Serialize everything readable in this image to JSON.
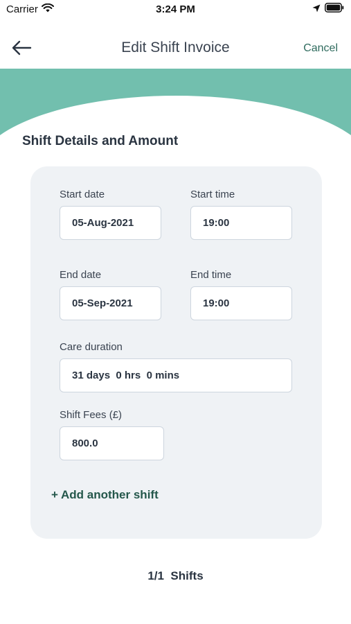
{
  "status_bar": {
    "carrier": "Carrier",
    "time": "3:24 PM",
    "icons": [
      "wifi-icon",
      "location-arrow-icon",
      "battery-icon"
    ]
  },
  "nav": {
    "back_icon": "arrow-left-icon",
    "title": "Edit Shift Invoice",
    "cancel_label": "Cancel"
  },
  "colors": {
    "header_teal": "#72bfae",
    "accent_green": "#2f6b5e",
    "card_bg": "#eff2f5"
  },
  "section_title": "Shift Details and Amount",
  "form": {
    "start_date": {
      "label": "Start date",
      "value": "05-Aug-2021"
    },
    "start_time": {
      "label": "Start time",
      "value": "19:00"
    },
    "end_date": {
      "label": "End date",
      "value": "05-Sep-2021"
    },
    "end_time": {
      "label": "End time",
      "value": "19:00"
    },
    "care_duration": {
      "label": "Care duration",
      "value": "31 days  0 hrs  0 mins"
    },
    "shift_fees": {
      "label": "Shift Fees (£)",
      "value": "800.0"
    }
  },
  "add_shift_label": "+ Add another shift",
  "pager_text": "1/1  Shifts"
}
